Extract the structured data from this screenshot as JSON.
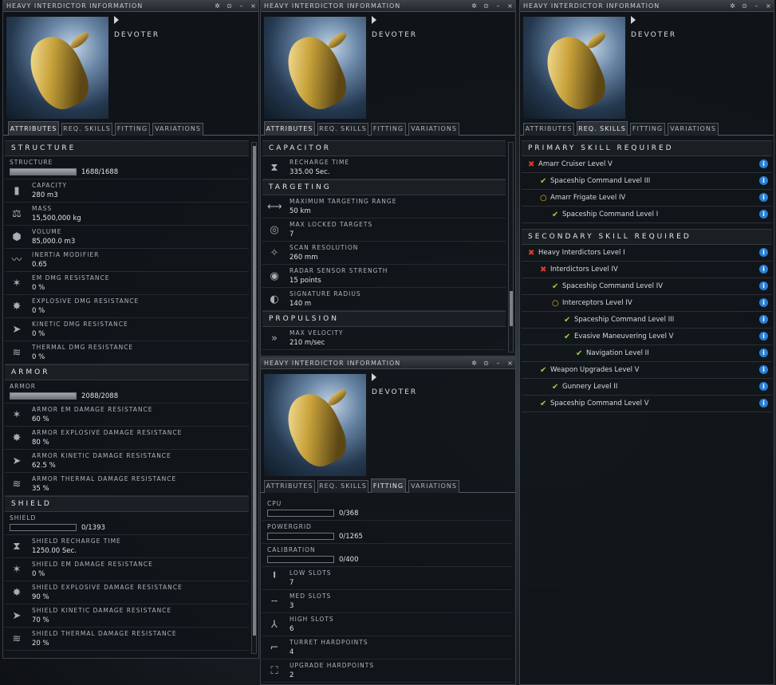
{
  "window_title": "HEAVY INTERDICTOR INFORMATION",
  "ship_name": "DEVOTER",
  "tabs": {
    "attributes": "ATTRIBUTES",
    "req_skills": "REQ. SKILLS",
    "fitting": "FITTING",
    "variations": "VARIATIONS"
  },
  "title_buttons": [
    "✲",
    "⊙",
    "–",
    "×"
  ],
  "w1": {
    "structure_section": "STRUCTURE",
    "structure": {
      "label": "STRUCTURE",
      "value": "1688/1688",
      "fraction": 1.0
    },
    "structure_rows": [
      {
        "icon": "capacity-icon",
        "glyph": "▮",
        "label": "CAPACITY",
        "value": "280 m3"
      },
      {
        "icon": "mass-icon",
        "glyph": "⚖",
        "label": "MASS",
        "value": "15,500,000 kg"
      },
      {
        "icon": "volume-icon",
        "glyph": "⬢",
        "label": "VOLUME",
        "value": "85,000.0 m3"
      },
      {
        "icon": "inertia-icon",
        "glyph": "〰",
        "label": "INERTIA MODIFIER",
        "value": "0.65"
      },
      {
        "icon": "em-icon",
        "glyph": "✶",
        "label": "EM DMG RESISTANCE",
        "value": "0 %"
      },
      {
        "icon": "explosive-icon",
        "glyph": "✸",
        "label": "EXPLOSIVE DMG RESISTANCE",
        "value": "0 %"
      },
      {
        "icon": "kinetic-icon",
        "glyph": "➤",
        "label": "KINETIC DMG RESISTANCE",
        "value": "0 %"
      },
      {
        "icon": "thermal-icon",
        "glyph": "≋",
        "label": "THERMAL DMG RESISTANCE",
        "value": "0 %"
      }
    ],
    "armor_section": "ARMOR",
    "armor": {
      "label": "ARMOR",
      "value": "2088/2088",
      "fraction": 1.0
    },
    "armor_rows": [
      {
        "icon": "em-icon",
        "glyph": "✶",
        "label": "ARMOR EM DAMAGE RESISTANCE",
        "value": "60 %"
      },
      {
        "icon": "explosive-icon",
        "glyph": "✸",
        "label": "ARMOR EXPLOSIVE DAMAGE RESISTANCE",
        "value": "80 %"
      },
      {
        "icon": "kinetic-icon",
        "glyph": "➤",
        "label": "ARMOR KINETIC DAMAGE RESISTANCE",
        "value": "62.5 %"
      },
      {
        "icon": "thermal-icon",
        "glyph": "≋",
        "label": "ARMOR THERMAL DAMAGE RESISTANCE",
        "value": "35 %"
      }
    ],
    "shield_section": "SHIELD",
    "shield": {
      "label": "SHIELD",
      "value": "0/1393",
      "fraction": 0.0
    },
    "shield_rows": [
      {
        "icon": "hourglass-icon",
        "glyph": "⧗",
        "label": "SHIELD RECHARGE TIME",
        "value": "1250.00 Sec."
      },
      {
        "icon": "em-icon",
        "glyph": "✶",
        "label": "SHIELD EM DAMAGE RESISTANCE",
        "value": "0 %"
      },
      {
        "icon": "explosive-icon",
        "glyph": "✸",
        "label": "SHIELD EXPLOSIVE DAMAGE RESISTANCE",
        "value": "90 %"
      },
      {
        "icon": "kinetic-icon",
        "glyph": "➤",
        "label": "SHIELD KINETIC DAMAGE RESISTANCE",
        "value": "70 %"
      },
      {
        "icon": "thermal-icon",
        "glyph": "≋",
        "label": "SHIELD THERMAL DAMAGE RESISTANCE",
        "value": "20 %"
      }
    ]
  },
  "w2": {
    "capacitor_section": "CAPACITOR",
    "capacitor_rows": [
      {
        "icon": "hourglass-icon",
        "glyph": "⧗",
        "label": "RECHARGE TIME",
        "value": "335.00 Sec."
      }
    ],
    "targeting_section": "TARGETING",
    "targeting_rows": [
      {
        "icon": "range-icon",
        "glyph": "⟷",
        "label": "MAXIMUM TARGETING RANGE",
        "value": "50 km"
      },
      {
        "icon": "target-icon",
        "glyph": "◎",
        "label": "MAX LOCKED TARGETS",
        "value": "7"
      },
      {
        "icon": "scan-icon",
        "glyph": "✧",
        "label": "SCAN RESOLUTION",
        "value": "260 mm"
      },
      {
        "icon": "radar-icon",
        "glyph": "◉",
        "label": "RADAR SENSOR STRENGTH",
        "value": "15 points"
      },
      {
        "icon": "signature-icon",
        "glyph": "◐",
        "label": "SIGNATURE RADIUS",
        "value": "140 m"
      }
    ],
    "propulsion_section": "PROPULSION",
    "propulsion_rows": [
      {
        "icon": "velocity-icon",
        "glyph": "»",
        "label": "MAX VELOCITY",
        "value": "210 m/sec"
      }
    ]
  },
  "w3": {
    "primary_header": "PRIMARY SKILL REQUIRED",
    "primary": [
      {
        "name": "Amarr Cruiser Level V",
        "status": "missing",
        "indent": 0
      },
      {
        "name": "Spaceship Command Level III",
        "status": "ok",
        "indent": 1
      },
      {
        "name": "Amarr Frigate Level IV",
        "status": "partial",
        "indent": 1
      },
      {
        "name": "Spaceship Command Level I",
        "status": "ok",
        "indent": 2
      }
    ],
    "secondary_header": "SECONDARY SKILL REQUIRED",
    "secondary": [
      {
        "name": "Heavy Interdictors Level I",
        "status": "missing",
        "indent": 0
      },
      {
        "name": "Interdictors Level IV",
        "status": "missing",
        "indent": 1
      },
      {
        "name": "Spaceship Command Level IV",
        "status": "ok",
        "indent": 2
      },
      {
        "name": "Interceptors Level IV",
        "status": "partial",
        "indent": 2
      },
      {
        "name": "Spaceship Command Level III",
        "status": "ok",
        "indent": 3
      },
      {
        "name": "Evasive Maneuvering Level V",
        "status": "ok",
        "indent": 3
      },
      {
        "name": "Navigation Level II",
        "status": "ok",
        "indent": 4
      },
      {
        "name": "Weapon Upgrades Level V",
        "status": "ok",
        "indent": 1
      },
      {
        "name": "Gunnery Level II",
        "status": "ok",
        "indent": 2
      },
      {
        "name": "Spaceship Command Level V",
        "status": "ok",
        "indent": 1
      }
    ],
    "info_glyph": "i",
    "status_glyphs": {
      "missing": "✖",
      "ok": "✔",
      "partial": "○"
    },
    "status_colors": {
      "missing": "#e03a2e",
      "ok": "#9bd13a",
      "partial": "#e8b81e"
    }
  },
  "w4": {
    "bars": [
      {
        "label": "CPU",
        "value": "0/368",
        "fraction": 0.0
      },
      {
        "label": "POWERGRID",
        "value": "0/1265",
        "fraction": 0.0
      },
      {
        "label": "CALIBRATION",
        "value": "0/400",
        "fraction": 0.0
      }
    ],
    "rows": [
      {
        "icon": "low-slot-icon",
        "glyph": "╹",
        "label": "LOW SLOTS",
        "value": "7"
      },
      {
        "icon": "med-slot-icon",
        "glyph": "╌",
        "label": "MED SLOTS",
        "value": "3"
      },
      {
        "icon": "high-slot-icon",
        "glyph": "⅄",
        "label": "HIGH SLOTS",
        "value": "6"
      },
      {
        "icon": "turret-icon",
        "glyph": "⌐",
        "label": "TURRET HARDPOINTS",
        "value": "4"
      },
      {
        "icon": "upgrade-icon",
        "glyph": "⛶",
        "label": "UPGRADE HARDPOINTS",
        "value": "2"
      }
    ]
  }
}
